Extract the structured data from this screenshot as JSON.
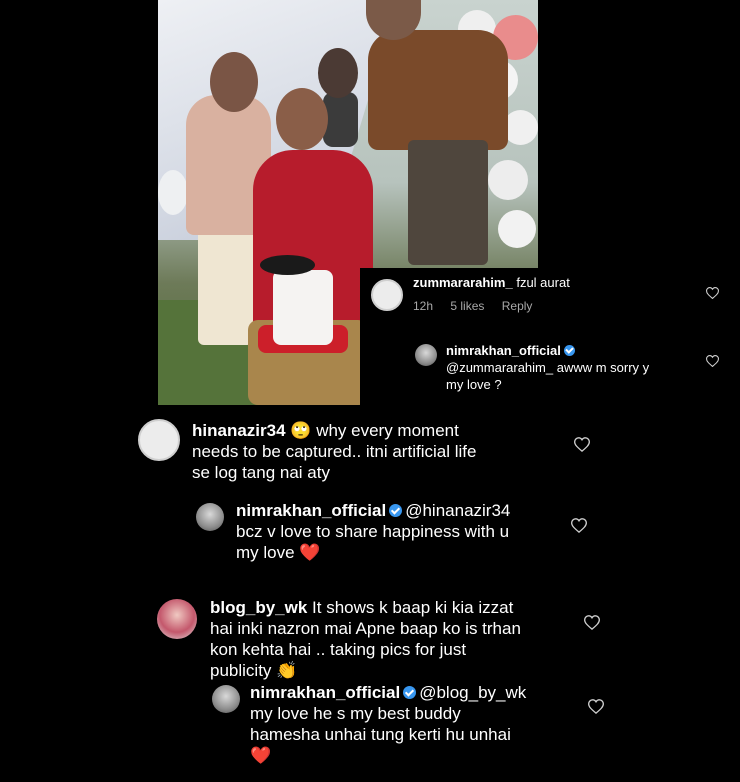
{
  "popup": {
    "comment": {
      "username": "zummararahim_",
      "text": "fzul aurat",
      "time": "12h",
      "likes": "5 likes",
      "reply_label": "Reply"
    },
    "reply": {
      "username": "nimrakhan_official",
      "line1": "@zummararahim_  awww m sorry y",
      "line2": "my love ?"
    }
  },
  "comments": [
    {
      "username": "hinanazir34",
      "emoji": "🙄",
      "line1": "why every moment",
      "line2": "needs to be captured.. itni artificial life",
      "line3": "se log tang nai aty"
    },
    {
      "username": "nimrakhan_official",
      "mention": "@hinanazir34",
      "line2": "bcz v love to share happiness with u",
      "line3": "my love",
      "emoji": "❤️"
    },
    {
      "username": "blog_by_wk",
      "line1": "It shows k baap ki kia izzat",
      "line2": "hai inki nazron mai Apne baap ko is trhan",
      "line3": "kon kehta hai .. taking pics for just",
      "line4": "publicity",
      "emoji": "👏"
    },
    {
      "username": "nimrakhan_official",
      "mention": "@blog_by_wk",
      "line2": "my love he s my best buddy",
      "line3": "hamesha unhai tung kerti hu unhai",
      "emoji": "❤️"
    }
  ],
  "icons": {
    "heart": "heart-outline-icon",
    "verified": "verified-badge-icon",
    "avatar_default": "default-avatar-icon"
  },
  "colors": {
    "background": "#000000",
    "text": "#ffffff",
    "meta": "#a8a8a8",
    "verified": "#3897f0",
    "red_heart": "#e0112a"
  }
}
